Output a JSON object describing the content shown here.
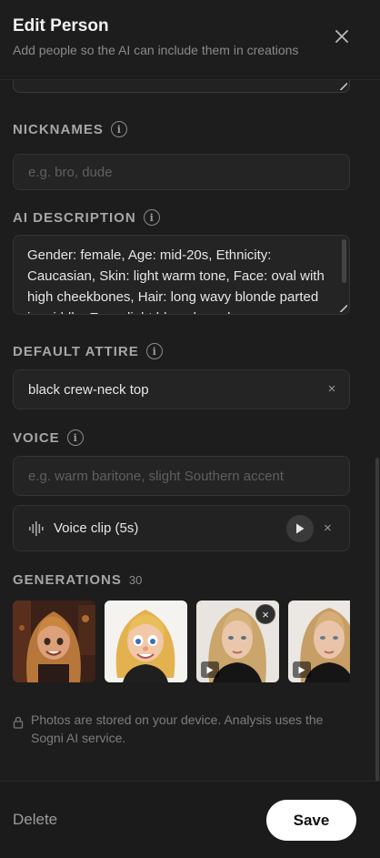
{
  "header": {
    "title": "Edit Person",
    "subtitle": "Add people so the AI can include them in creations",
    "close_icon": "close-icon"
  },
  "nicknames": {
    "label": "NICKNAMES",
    "placeholder": "e.g. bro, dude",
    "value": ""
  },
  "ai_description": {
    "label": "AI DESCRIPTION",
    "value": "Gender: female, Age: mid-20s, Ethnicity: Caucasian, Skin: light warm tone, Face: oval with high cheekbones, Hair: long wavy blonde parted in middle, Eyes: light blue almond"
  },
  "default_attire": {
    "label": "DEFAULT ATTIRE",
    "value": "black crew-neck top",
    "clear_glyph": "×"
  },
  "voice": {
    "label": "VOICE",
    "placeholder": "e.g. warm baritone, slight Southern accent",
    "clip_label": "Voice clip (5s)",
    "clip_remove_glyph": "×"
  },
  "generations": {
    "label": "GENERATIONS",
    "count": "30",
    "remove_glyph": "×",
    "items": [
      {
        "name": "cartoon-woman-brown-hair",
        "kind": "image"
      },
      {
        "name": "cartoon-woman-blonde",
        "kind": "image"
      },
      {
        "name": "photo-woman-blonde",
        "kind": "video"
      },
      {
        "name": "photo-woman-blonde-2",
        "kind": "video"
      }
    ]
  },
  "privacy": {
    "text": "Photos are stored on your device. Analysis uses the Sogni AI service.",
    "icon": "lock-icon"
  },
  "footer": {
    "delete_label": "Delete",
    "save_label": "Save"
  },
  "colors": {
    "background": "#1d1d1d",
    "primary_button": "#ffffff",
    "muted_text": "#8a8a8a"
  }
}
